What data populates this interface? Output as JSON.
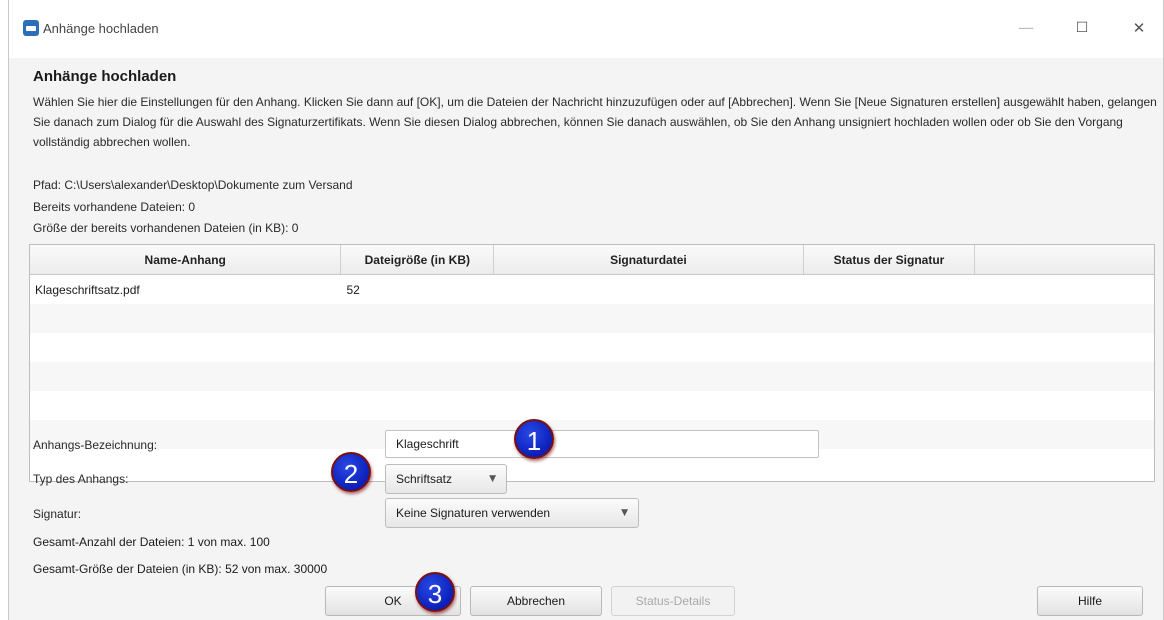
{
  "window": {
    "title": "Anhänge hochladen"
  },
  "dialog": {
    "heading": "Anhänge hochladen",
    "description": "Wählen Sie hier die Einstellungen für den Anhang. Klicken Sie dann auf [OK], um die Dateien der Nachricht hinzuzufügen oder auf [Abbrechen]. Wenn Sie [Neue Signaturen erstellen] ausgewählt haben, gelangen Sie danach zum Dialog für die Auswahl des Signaturzertifikats. Wenn Sie diesen Dialog abbrechen, können Sie danach auswählen, ob Sie den Anhang unsigniert hochladen wollen oder ob Sie den Vorgang vollständig abbrechen wollen.",
    "path": "Pfad: C:\\Users\\alexander\\Desktop\\Dokumente zum Versand",
    "existing_files": "Bereits vorhandene Dateien: 0",
    "existing_size": "Größe der bereits vorhandenen Dateien (in KB): 0"
  },
  "table": {
    "columns": [
      "Name-Anhang",
      "Dateigröße (in KB)",
      "Signaturdatei",
      "Status der Signatur",
      ""
    ],
    "rows": [
      [
        "Klageschriftsatz.pdf",
        "52",
        "",
        "",
        ""
      ]
    ]
  },
  "form": {
    "name_label": "Anhangs-Bezeichnung:",
    "name_value": "Klageschrift",
    "type_label": "Typ des Anhangs:",
    "type_value": "Schriftsatz",
    "signature_label": "Signatur:",
    "signature_value": "Keine Signaturen verwenden"
  },
  "summary": {
    "count": "Gesamt-Anzahl der Dateien: 1 von max. 100",
    "size": "Gesamt-Größe der Dateien (in KB): 52 von max. 30000"
  },
  "buttons": {
    "ok": "OK",
    "cancel": "Abbrechen",
    "status_details": "Status-Details",
    "help": "Hilfe"
  },
  "badges": [
    "1",
    "2",
    "3"
  ],
  "colors": {
    "badge": "#0b1fb8",
    "accent": "#2c6fb6"
  }
}
